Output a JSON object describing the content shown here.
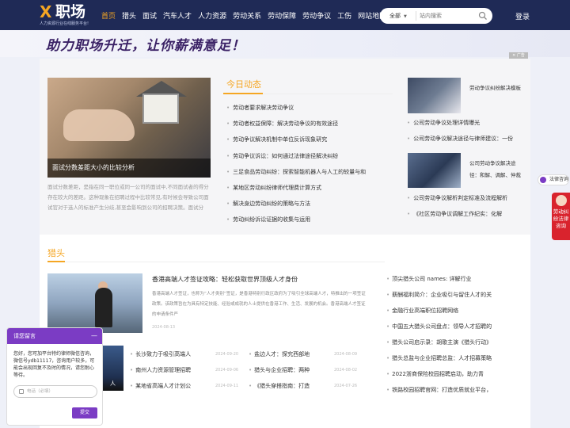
{
  "logo": {
    "mark": "X",
    "text": "职场",
    "slogan": "人力资源行业在线服务平台!"
  },
  "nav": [
    "首页",
    "猎头",
    "面试",
    "汽车人才",
    "人力资源",
    "劳动关系",
    "劳动保障",
    "劳动争议",
    "工伤",
    "网站地图"
  ],
  "search": {
    "scope": "全部",
    "placeholder": "站内搜索"
  },
  "login": "登录",
  "banner": {
    "text": "助力职场升迁，让你薪满意足！",
    "ad_label": "广告",
    "close": "✕"
  },
  "featured": {
    "caption": "面试分数差距大小的比较分析",
    "desc": "面试分数差距，是指在同一职位或同一公司的面试中,不同面试者的得分存在较大的差距。这种现象在招聘过程中比较常见,有时候会导致公司面试官对于选人的标准产生分歧,甚至会影响到公司的招聘决策。面试分"
  },
  "today": {
    "title": "今日动态",
    "items": [
      "劳动者要求解决劳动争议",
      "劳动者权益保障：解决劳动争议的有效途径",
      "劳动争议解决机制中单位反诉现象研究",
      "劳动争议诉讼：如何通过法律途径解决纠纷",
      "三足食品劳动纠纷：探索智能机器人与人工的较量与和",
      "某地区劳动纠纷律师代理费计算方式",
      "解决身边劳动纠纷的策略与方法",
      "劳动纠纷诉讼证据的收集与运用"
    ]
  },
  "side": {
    "t1": "劳动争议纠纷解决模板",
    "list1": [
      "公司劳动争议处理详情曝光",
      "公司劳动争议解决途径与律师建议：一份"
    ],
    "t2": "公司劳动争议解决途径：和解、调解、仲裁",
    "list2": [
      "公司劳动争议解析判定标准及流程解析",
      "《社区劳动争议调解工作纪实：化解"
    ]
  },
  "headhunter": {
    "title": "猎头",
    "feature_title": "香港高端人才签证攻略：轻松获取世界顶级人才身份",
    "feature_desc": "香港高端人才签证，也称为“人才类别”签证，是香港特别行政区政府为了吸引全球高端人才，特推出的一项签证政策。该政策旨在为具有特定技能、经验或成就的人士提供在香港工作、生活、发展的机会。香港高端人才签证的申请条件严",
    "feature_date": "2024-08-13",
    "small_img_text": "人",
    "grid": [
      {
        "t": "长沙致力于吸引高端人",
        "d": "2024-09-20"
      },
      {
        "t": "盐边人才：探究西部地",
        "d": "2024-08-09"
      },
      {
        "t": "南州人力资源管理招聘",
        "d": "2024-09-06"
      },
      {
        "t": "猎头与企业招聘：两种",
        "d": "2024-08-02"
      },
      {
        "t": "某地省高端人才计划公",
        "d": "2024-09-11"
      },
      {
        "t": "《猎头穿搭指南：打造",
        "d": "2024-07-26"
      }
    ],
    "right": [
      "顶尖猎头公司 names: 详解行业",
      "薪酬福利简介：企业吸引与留住人才的关",
      "金融行业高端职位招聘网络",
      "中国五大猎头公司盘点：领导人才招聘的",
      "猎头公司启示录：胡歌主演《猎头行动》",
      "猎头总监与企业招聘总监：人才招募策略",
      "2022浙商保险校园招聘启动，助力青",
      "铁路校园招聘官网：打造优质就业平台，"
    ]
  },
  "chat": {
    "title": "请您留言",
    "min": "—",
    "message": "您好，您可加平台特约律师微信咨询，微信号ydb11117，咨询用户较多，可能会出现回复不及时的情况，请您耐心等待。",
    "placeholder": "电话（必填）",
    "submit": "提交"
  },
  "float": {
    "lawyer": "法律咨询",
    "help": "劳动纠纷法律咨询"
  },
  "colors": {
    "nav_bg": "#1f2a56",
    "accent": "#f5a623",
    "chat": "#7b3cc4",
    "help": "#d9232d"
  }
}
